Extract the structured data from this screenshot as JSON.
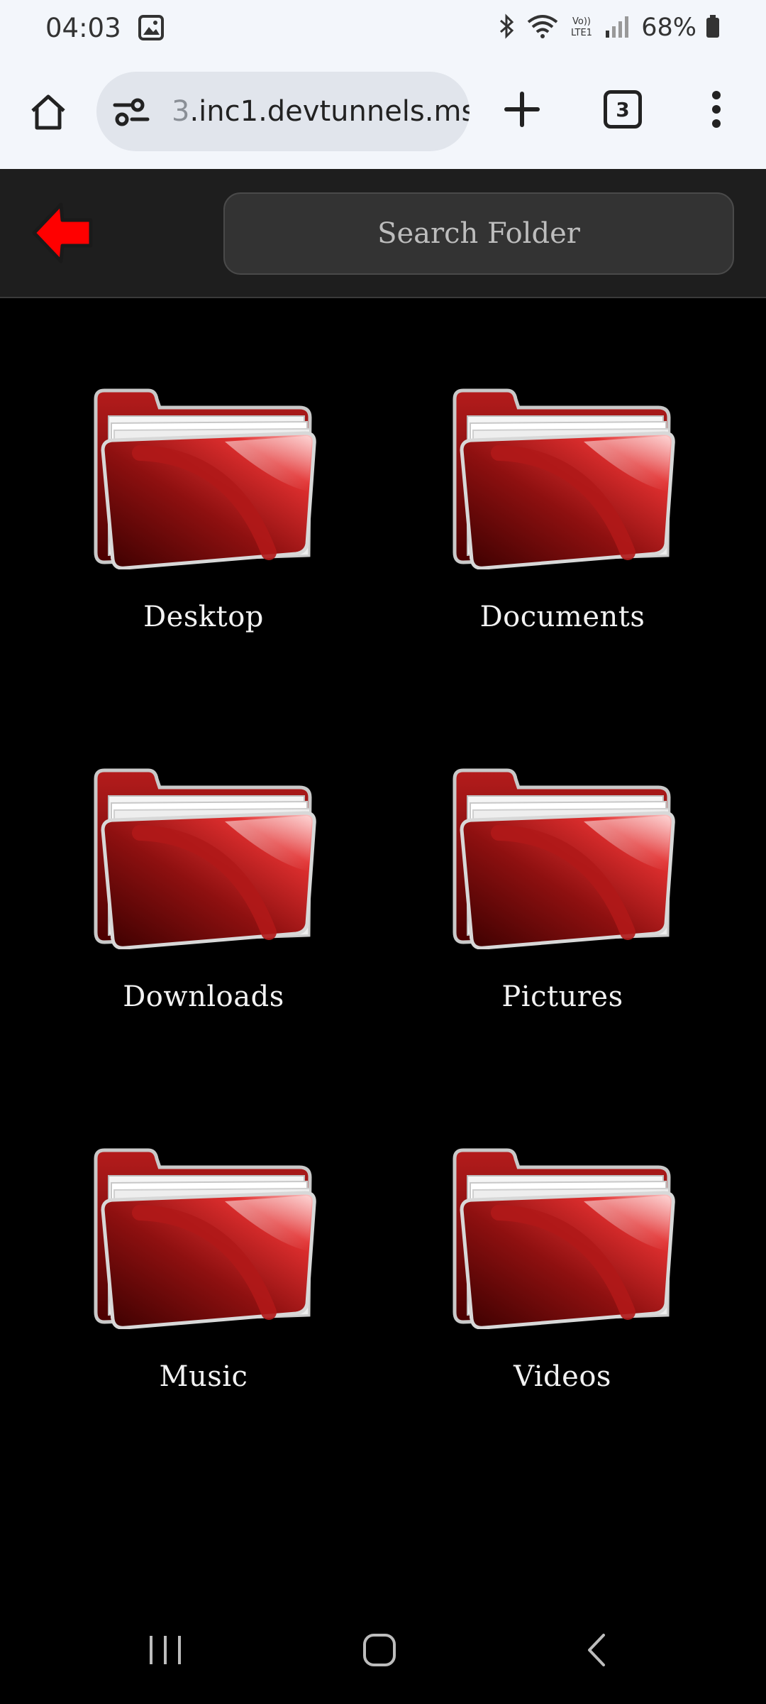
{
  "status_bar": {
    "time": "04:03",
    "battery": "68%",
    "icons": [
      "image-icon",
      "bluetooth-icon",
      "wifi-icon",
      "volte-icon",
      "signal-icon",
      "battery-icon"
    ]
  },
  "browser": {
    "url_faded": "3",
    "url_main": ".inc1.devtunnels.ms",
    "tab_count": "3"
  },
  "app_header": {
    "search_placeholder": "Search Folder",
    "accent_color": "#e10000"
  },
  "folders": [
    {
      "label": "Desktop"
    },
    {
      "label": "Documents"
    },
    {
      "label": "Downloads"
    },
    {
      "label": "Pictures"
    },
    {
      "label": "Music"
    },
    {
      "label": "Videos"
    }
  ]
}
